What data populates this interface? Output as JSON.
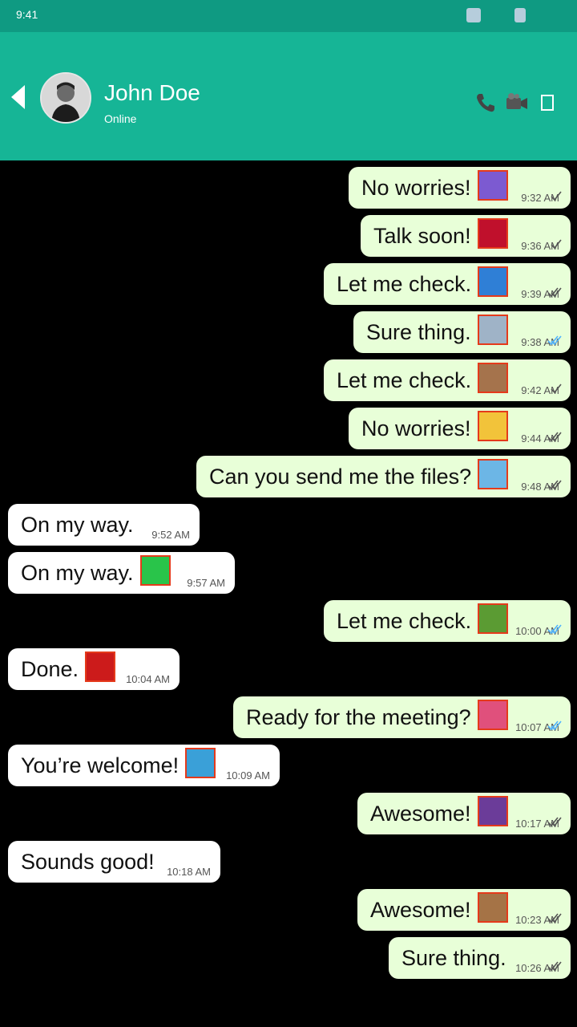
{
  "status_bar": {
    "time": "9:41",
    "icons": [
      "signal-icon",
      "battery-icon"
    ]
  },
  "header": {
    "back_icon": "back-arrow-icon",
    "contact_name": "John Doe",
    "presence": "Online",
    "actions": [
      "phone-icon",
      "video-camera-icon",
      "more-icon"
    ],
    "colors": {
      "bar": "#16b596",
      "status": "#0f9a82"
    }
  },
  "chat": {
    "colors": {
      "outgoing": "#e8ffd8",
      "incoming": "#ffffff",
      "read_tick": "#4fb3ff",
      "sent_tick": "#555555"
    },
    "messages": [
      {
        "dir": "out",
        "text": "No worries!",
        "emoji": "cyclist-emoji",
        "time": "9:32 AM",
        "tick": "sent"
      },
      {
        "dir": "out",
        "text": "Talk soon!",
        "emoji": "angola-flag-emoji",
        "time": "9:36 AM",
        "tick": "sent"
      },
      {
        "dir": "out",
        "text": "Let me check.",
        "emoji": "blue-cap-emoji",
        "time": "9:39 AM",
        "tick": "delivered"
      },
      {
        "dir": "out",
        "text": "Sure thing.",
        "emoji": "technologist-emoji",
        "time": "9:38 AM",
        "tick": "read"
      },
      {
        "dir": "out",
        "text": "Let me check.",
        "emoji": "person-bowing-emoji",
        "time": "9:42 AM",
        "tick": "sent"
      },
      {
        "dir": "out",
        "text": "No worries!",
        "emoji": "pointing-finger-emoji",
        "time": "9:44 AM",
        "tick": "delivered"
      },
      {
        "dir": "out",
        "text": "Can you send me the files?",
        "emoji": "botswana-flag-emoji",
        "time": "9:48 AM",
        "tick": "delivered"
      },
      {
        "dir": "in",
        "text": "On my way.",
        "emoji": null,
        "time": "9:52 AM"
      },
      {
        "dir": "in",
        "text": "On my way.",
        "emoji": "green-heart-emoji",
        "time": "9:57 AM"
      },
      {
        "dir": "out",
        "text": "Let me check.",
        "emoji": "weightlifter-emoji",
        "time": "10:00 AM",
        "tick": "read"
      },
      {
        "dir": "in",
        "text": "Done.",
        "emoji": "samoa-flag-emoji",
        "time": "10:04 AM"
      },
      {
        "dir": "out",
        "text": "Ready for the meeting?",
        "emoji": "female-sign-emoji",
        "time": "10:07 AM",
        "tick": "read"
      },
      {
        "dir": "in",
        "text": "You’re welcome!",
        "emoji": "selfie-emoji",
        "time": "10:09 AM"
      },
      {
        "dir": "out",
        "text": "Awesome!",
        "emoji": "supervillain-emoji",
        "time": "10:17 AM",
        "tick": "delivered"
      },
      {
        "dir": "in",
        "text": "Sounds good!",
        "emoji": null,
        "time": "10:18 AM"
      },
      {
        "dir": "out",
        "text": "Awesome!",
        "emoji": "bride-with-veil-emoji",
        "time": "10:23 AM",
        "tick": "delivered"
      },
      {
        "dir": "out",
        "text": "Sure thing.",
        "emoji": null,
        "time": "10:26 AM",
        "tick": "delivered"
      }
    ]
  }
}
